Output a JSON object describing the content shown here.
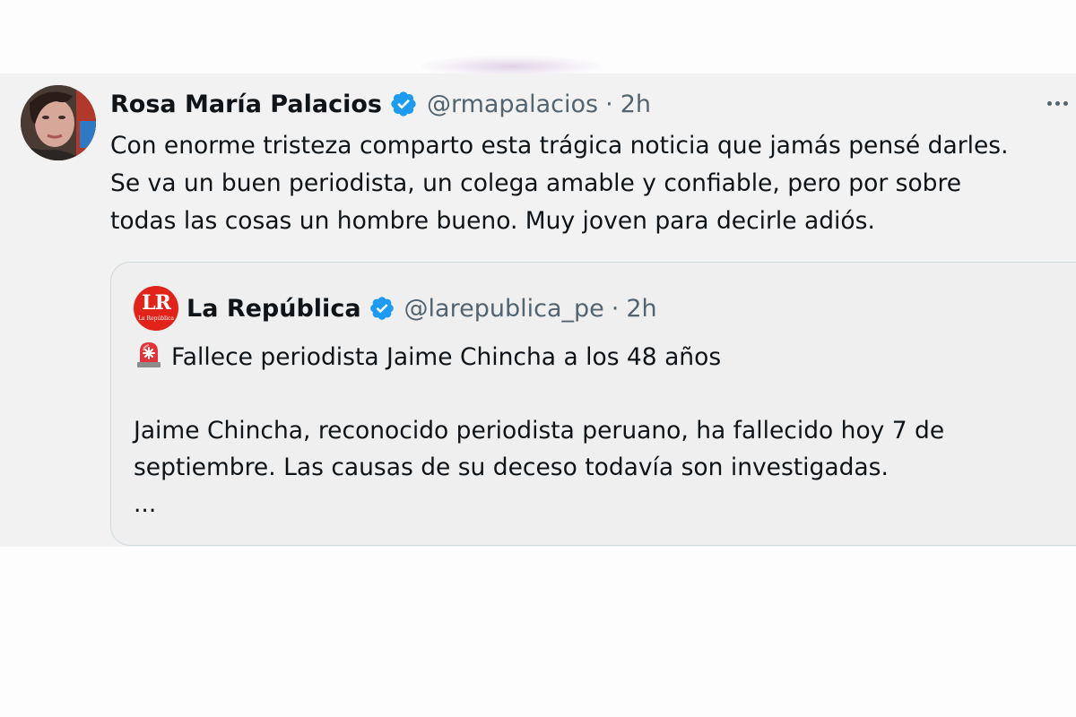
{
  "tweet": {
    "author_name": "Rosa María Palacios",
    "handle": "@rmapalacios",
    "separator": "·",
    "time": "2h",
    "body_lines": [
      "Con enorme tristeza comparto esta trágica noticia que jamás pensé darles.",
      "Se va un buen periodista, un colega amable y confiable, pero por sobre",
      "todas las cosas un hombre bueno. Muy joven para decirle adiós."
    ],
    "icons": {
      "verified": "verified-badge-icon",
      "more": "more-options-icon"
    }
  },
  "quote": {
    "avatar_text": "LR",
    "avatar_subtext": "La República",
    "author_name": "La República",
    "handle": "@larepublica_pe",
    "separator": "·",
    "time": "2h",
    "headline": "Fallece periodista Jaime Chincha a los 48 años",
    "body_lines": [
      "Jaime Chincha, reconocido periodista peruano, ha fallecido hoy 7 de",
      "septiembre. Las causas de su deceso todavía son investigadas."
    ],
    "ellipsis": "...",
    "icons": {
      "siren": "rotating-light-icon"
    }
  },
  "colors": {
    "verified_blue": "#1d9bf0",
    "secondary_text": "#536471",
    "primary_text": "#0f1419",
    "tweet_background": "#f2f2f2",
    "quote_border": "#cfd9de",
    "brand_red": "#e2231a"
  }
}
